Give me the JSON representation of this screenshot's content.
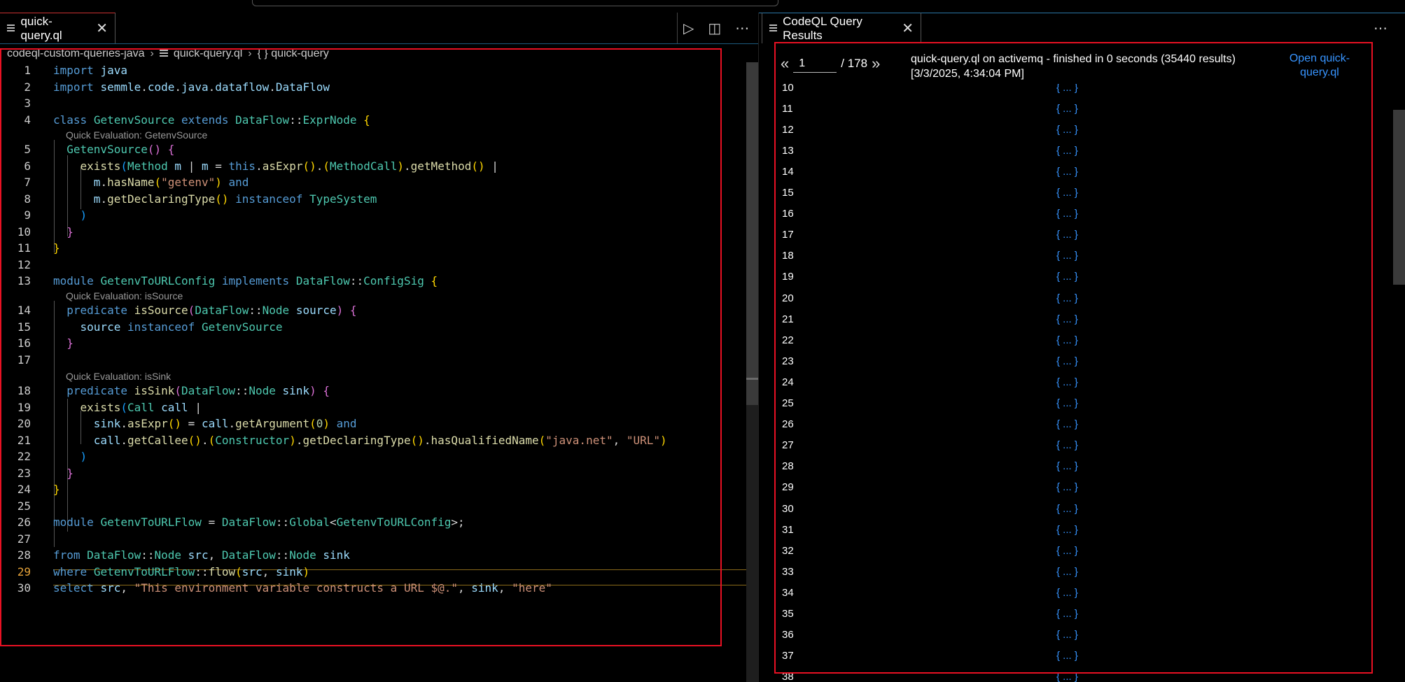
{
  "editor": {
    "tab_label": "quick-query.ql",
    "tab_close": "✕",
    "breadcrumb": [
      "codeql-custom-queries-java",
      "quick-query.ql",
      "{ } quick-query"
    ],
    "lens": {
      "l4": "Quick Evaluation: GetenvSource",
      "l13": "Quick Evaluation: isSource",
      "l17": "Quick Evaluation: isSink"
    },
    "line_numbers": [
      "1",
      "2",
      "3",
      "4",
      "5",
      "6",
      "7",
      "8",
      "9",
      "10",
      "11",
      "12",
      "13",
      "14",
      "15",
      "16",
      "17",
      "18",
      "19",
      "20",
      "21",
      "22",
      "23",
      "24",
      "25",
      "26",
      "27",
      "28",
      "29",
      "30"
    ],
    "active_line": "29"
  },
  "results": {
    "tab_label": "CodeQL Query Results",
    "tab_close": "✕",
    "page_value": "1",
    "page_total": "/ 178",
    "prev": "«",
    "next": "»",
    "status_line1": "quick-query.ql on activemq - finished in 0 seconds (35440 results)",
    "status_line2": "[3/3/2025, 4:34:04 PM]",
    "open_link": "Open quick-query.ql",
    "rows": [
      "10",
      "11",
      "12",
      "13",
      "14",
      "15",
      "16",
      "17",
      "18",
      "19",
      "20",
      "21",
      "22",
      "23",
      "24",
      "25",
      "26",
      "27",
      "28",
      "29",
      "30",
      "31",
      "32",
      "33",
      "34",
      "35",
      "36",
      "37",
      "38"
    ],
    "cell_value": "{ ... }"
  },
  "actions": {
    "run": "▷",
    "split": "◫",
    "more": "⋯"
  }
}
